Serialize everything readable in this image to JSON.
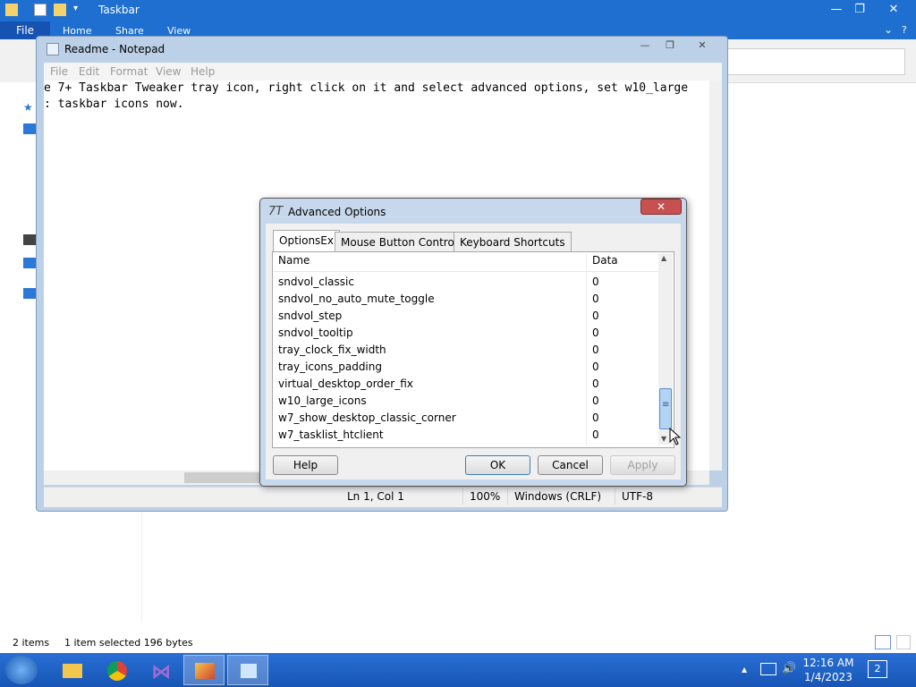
{
  "explorer": {
    "title": "Taskbar",
    "file_tab": "File",
    "ribbon_tabs": [
      "Home",
      "Share",
      "View"
    ],
    "win_controls": {
      "minimize": "—",
      "maximize": "❐",
      "close": "✕"
    },
    "help_glyph": "?",
    "chevron_glyph": "⌄",
    "status": {
      "items": "2 items",
      "selected": "1 item selected  196 bytes"
    }
  },
  "notepad": {
    "title": "Readme - Notepad",
    "menu": [
      "File",
      "Edit",
      "Format",
      "View",
      "Help"
    ],
    "text_line1": "e 7+ Taskbar Tweaker tray icon, right click on it and select advanced options, set w10_large",
    "text_line2": ": taskbar icons now.",
    "status": {
      "position": "Ln 1, Col 1",
      "zoom": "100%",
      "eol": "Windows (CRLF)",
      "encoding": "UTF-8"
    }
  },
  "dialog": {
    "title": "Advanced Options",
    "close_glyph": "✕",
    "tabs": [
      "OptionsEx",
      "Mouse Button Control",
      "Keyboard Shortcuts"
    ],
    "columns": {
      "name": "Name",
      "data": "Data"
    },
    "rows": [
      {
        "name": "sndvol_classic",
        "data": "0"
      },
      {
        "name": "sndvol_no_auto_mute_toggle",
        "data": "0"
      },
      {
        "name": "sndvol_step",
        "data": "0"
      },
      {
        "name": "sndvol_tooltip",
        "data": "0"
      },
      {
        "name": "tray_clock_fix_width",
        "data": "0"
      },
      {
        "name": "tray_icons_padding",
        "data": "0"
      },
      {
        "name": "virtual_desktop_order_fix",
        "data": "0"
      },
      {
        "name": "w10_large_icons",
        "data": "0"
      },
      {
        "name": "w7_show_desktop_classic_corner",
        "data": "0"
      },
      {
        "name": "w7_tasklist_htclient",
        "data": "0"
      }
    ],
    "buttons": {
      "help": "Help",
      "ok": "OK",
      "cancel": "Cancel",
      "apply": "Apply"
    },
    "scroll_up_glyph": "▲",
    "scroll_down_glyph": "▼",
    "thumb_grip": "≡"
  },
  "taskbar": {
    "clock_time": "12:16 AM",
    "clock_date": "1/4/2023",
    "notification_count": "2",
    "tray_glyph": "▲",
    "volume_glyph": "🔊"
  }
}
